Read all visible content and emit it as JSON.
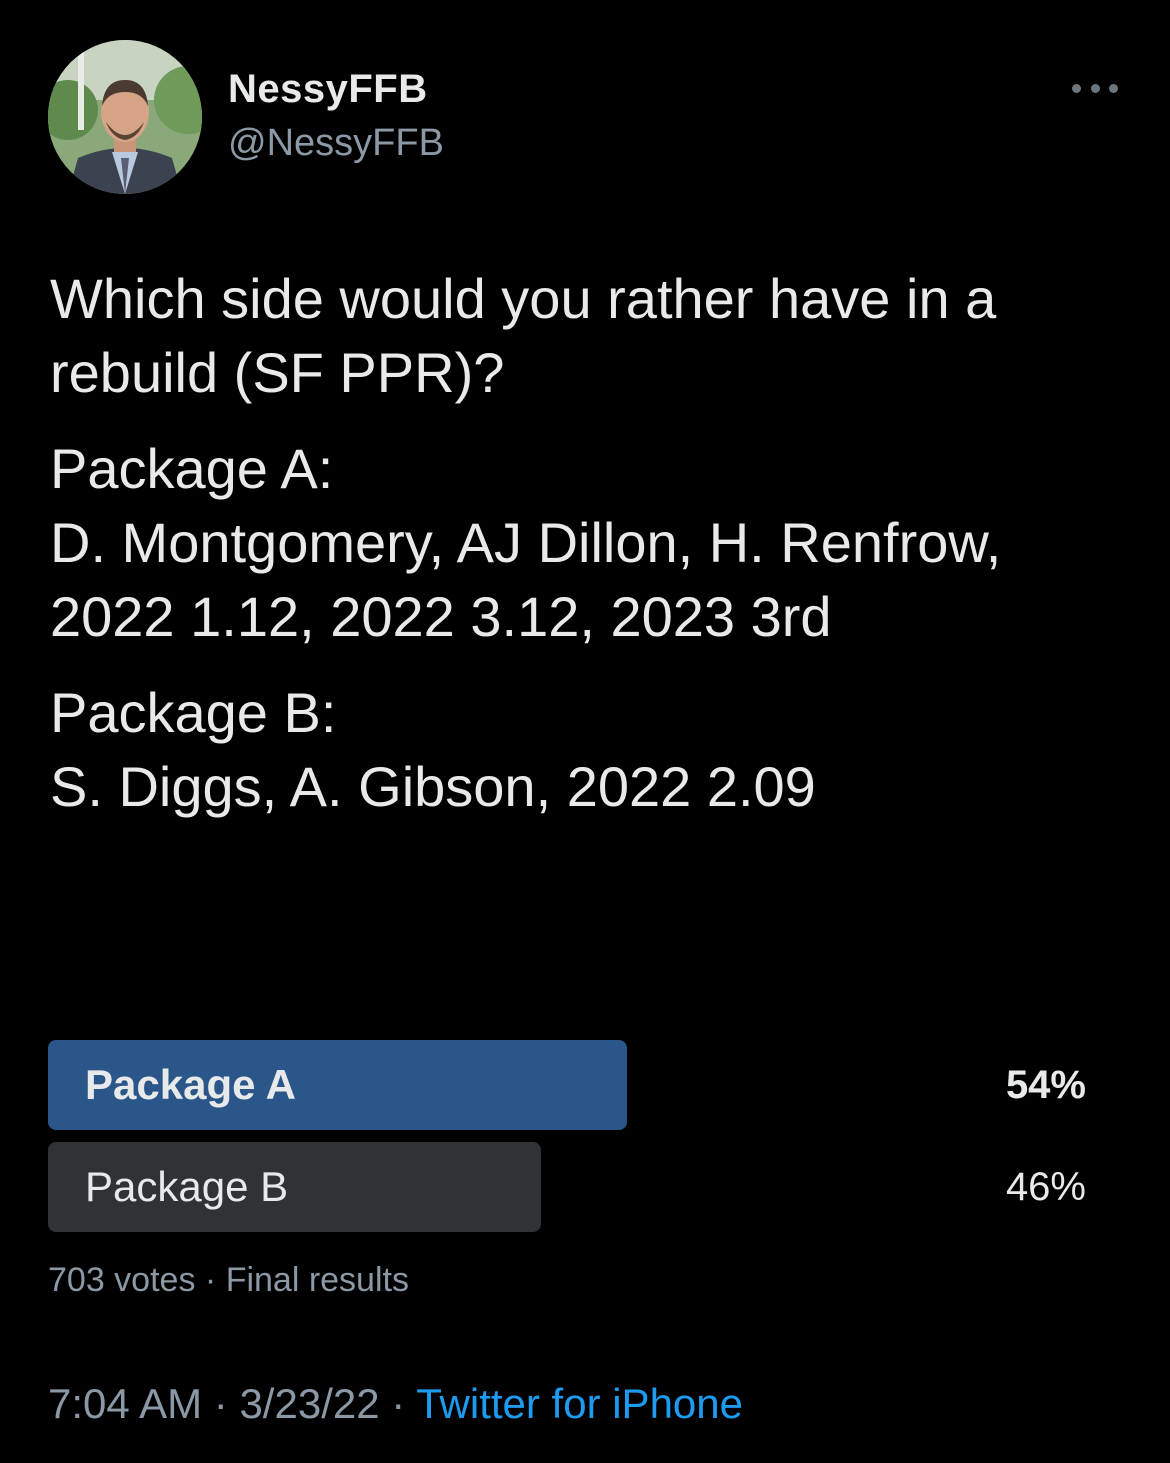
{
  "author": {
    "display_name": "NessyFFB",
    "handle": "@NessyFFB"
  },
  "tweet": {
    "paragraphs": [
      "Which side would you rather have in a rebuild (SF PPR)?",
      "Package A:\nD. Montgomery, AJ Dillon, H. Renfrow, 2022 1.12, 2022 3.12, 2023 3rd",
      "Package B:\nS. Diggs, A. Gibson, 2022 2.09"
    ]
  },
  "poll": {
    "options": [
      {
        "label": "Package A",
        "percent_text": "54%",
        "percent": 54,
        "winner": true
      },
      {
        "label": "Package B",
        "percent_text": "46%",
        "percent": 46,
        "winner": false
      }
    ],
    "votes": "703 votes",
    "separator": "·",
    "status": "Final results"
  },
  "footer": {
    "time": "7:04 AM",
    "separator": "·",
    "date": "3/23/22",
    "source": "Twitter for iPhone"
  },
  "colors": {
    "background": "#000000",
    "text_primary": "#e7e9ea",
    "text_secondary": "#8b98a5",
    "link": "#1d9bf0",
    "poll_winner_bar": "#2a5689",
    "poll_other_bar": "#2f3336"
  },
  "icons": {
    "more": "more-horizontal-icon"
  }
}
